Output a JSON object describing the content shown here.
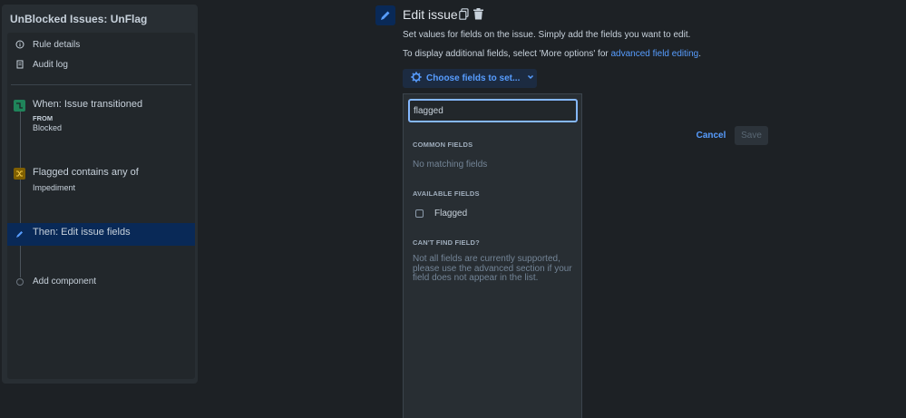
{
  "rule": {
    "title": "UnBlocked Issues: UnFlag",
    "menu": {
      "rule_details": "Rule details",
      "audit_log": "Audit log"
    },
    "steps": {
      "trigger": {
        "title": "When: Issue transitioned",
        "sub_label": "FROM",
        "sub_value": "Blocked"
      },
      "condition": {
        "title": "Flagged contains any of",
        "sub_value": "Impediment"
      },
      "action": {
        "title": "Then: Edit issue fields"
      },
      "add": {
        "title": "Add component"
      }
    }
  },
  "editor": {
    "title": "Edit issue",
    "description": "Set values for fields on the issue. Simply add the fields you want to edit.",
    "more_prefix": "To display additional fields, select 'More options' for ",
    "more_link": "advanced field editing",
    "more_suffix": ".",
    "choose_button": "Choose fields to set...",
    "cancel": "Cancel",
    "save": "Save"
  },
  "dropdown": {
    "search_value": "flagged",
    "common_heading": "COMMON FIELDS",
    "common_empty": "No matching fields",
    "available_heading": "AVAILABLE FIELDS",
    "available_items": [
      {
        "label": "Flagged",
        "checked": false
      }
    ],
    "cant_find_heading": "CAN'T FIND FIELD?",
    "cant_find_text": "Not all fields are currently supported, please use the advanced section if your field does not appear in the list."
  },
  "colors": {
    "background": "#1d2125",
    "accent": "#579dff",
    "trigger_icon": "#1f845a",
    "condition_icon": "#7f5f01",
    "active_step": "#092957"
  },
  "icons": {
    "rule_details": "info-icon",
    "audit_log": "document-icon",
    "trigger": "transition-icon",
    "condition": "branch-icon",
    "action": "pencil-icon",
    "header_copy": "copy-icon",
    "header_delete": "trash-icon",
    "choose": "gear-icon",
    "chevron": "chevron-down-icon"
  }
}
